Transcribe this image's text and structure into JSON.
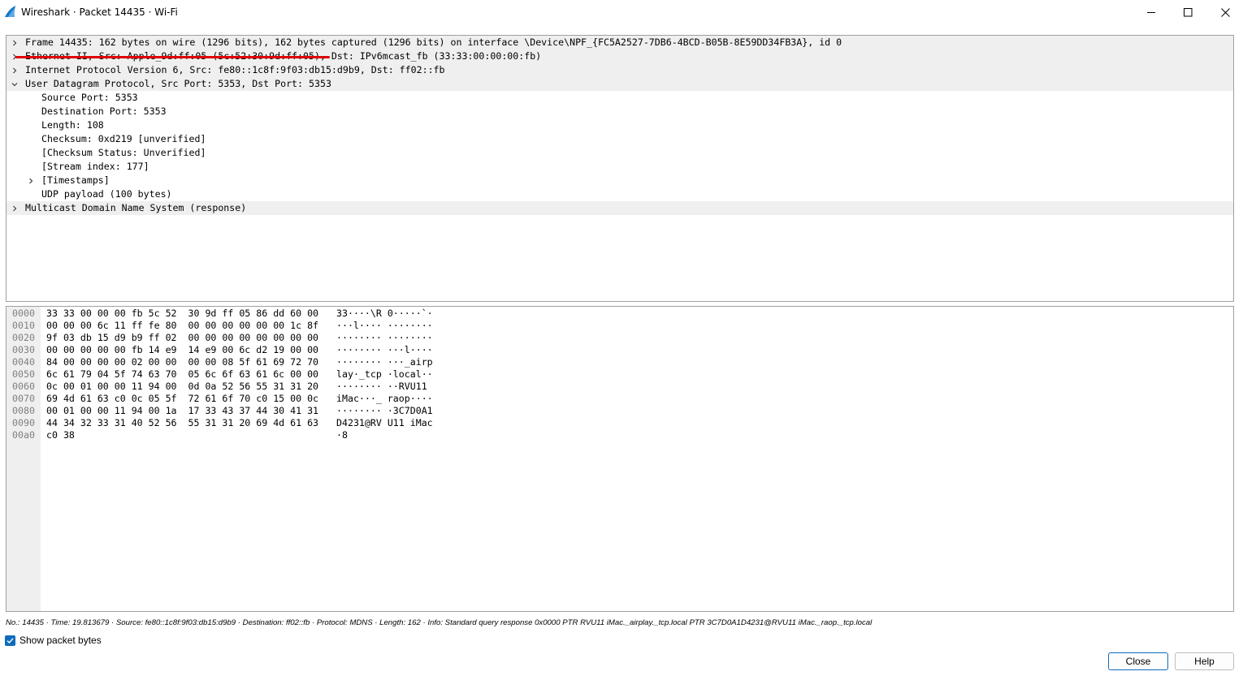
{
  "window": {
    "title": "Wireshark · Packet 14435 · Wi-Fi",
    "icon": "wireshark-fin-icon",
    "accent": "#0f6cbd"
  },
  "tree": {
    "rows": [
      {
        "text": "Frame 14435: 162 bytes on wire (1296 bits), 162 bytes captured (1296 bits) on interface \\Device\\NPF_{FC5A2527-7DB6-4BCD-B05B-8E59DD34FB3A}, id 0",
        "expander": "collapsed",
        "level": 0,
        "shaded": true
      },
      {
        "text": "Ethernet II, Src: Apple_9d:ff:05 (5c:52:30:9d:ff:05), Dst: IPv6mcast_fb (33:33:00:00:00:fb)",
        "expander": "collapsed",
        "level": 0,
        "shaded": true
      },
      {
        "text": "Internet Protocol Version 6, Src: fe80::1c8f:9f03:db15:d9b9, Dst: ff02::fb",
        "expander": "collapsed",
        "level": 0,
        "shaded": true
      },
      {
        "text": "User Datagram Protocol, Src Port: 5353, Dst Port: 5353",
        "expander": "expanded",
        "level": 0,
        "shaded": true
      },
      {
        "text": "Source Port: 5353",
        "expander": "none",
        "level": 1,
        "shaded": false
      },
      {
        "text": "Destination Port: 5353",
        "expander": "none",
        "level": 1,
        "shaded": false
      },
      {
        "text": "Length: 108",
        "expander": "none",
        "level": 1,
        "shaded": false
      },
      {
        "text": "Checksum: 0xd219 [unverified]",
        "expander": "none",
        "level": 1,
        "shaded": false
      },
      {
        "text": "[Checksum Status: Unverified]",
        "expander": "none",
        "level": 1,
        "shaded": false
      },
      {
        "text": "[Stream index: 177]",
        "expander": "none",
        "level": 1,
        "shaded": false
      },
      {
        "text": "[Timestamps]",
        "expander": "collapsed",
        "level": 1,
        "shaded": false
      },
      {
        "text": "UDP payload (100 bytes)",
        "expander": "none",
        "level": 1,
        "shaded": false
      },
      {
        "text": "Multicast Domain Name System (response)",
        "expander": "collapsed",
        "level": 0,
        "shaded": true
      }
    ],
    "highlight_color": "#e00000"
  },
  "bytes": {
    "rows": [
      {
        "offset": "0000",
        "hex": "33 33 00 00 00 fb 5c 52  30 9d ff 05 86 dd 60 00",
        "ascii": "33····\\R 0·····`·"
      },
      {
        "offset": "0010",
        "hex": "00 00 00 6c 11 ff fe 80  00 00 00 00 00 00 1c 8f",
        "ascii": "···l···· ········"
      },
      {
        "offset": "0020",
        "hex": "9f 03 db 15 d9 b9 ff 02  00 00 00 00 00 00 00 00",
        "ascii": "········ ········"
      },
      {
        "offset": "0030",
        "hex": "00 00 00 00 00 fb 14 e9  14 e9 00 6c d2 19 00 00",
        "ascii": "········ ···l····"
      },
      {
        "offset": "0040",
        "hex": "84 00 00 00 00 02 00 00  00 00 08 5f 61 69 72 70",
        "ascii": "········ ···_airp"
      },
      {
        "offset": "0050",
        "hex": "6c 61 79 04 5f 74 63 70  05 6c 6f 63 61 6c 00 00",
        "ascii": "lay·_tcp ·local··"
      },
      {
        "offset": "0060",
        "hex": "0c 00 01 00 00 11 94 00  0d 0a 52 56 55 31 31 20",
        "ascii": "········ ··RVU11 "
      },
      {
        "offset": "0070",
        "hex": "69 4d 61 63 c0 0c 05 5f  72 61 6f 70 c0 15 00 0c",
        "ascii": "iMac···_ raop····"
      },
      {
        "offset": "0080",
        "hex": "00 01 00 00 11 94 00 1a  17 33 43 37 44 30 41 31",
        "ascii": "········ ·3C7D0A1"
      },
      {
        "offset": "0090",
        "hex": "44 34 32 33 31 40 52 56  55 31 31 20 69 4d 61 63",
        "ascii": "D4231@RV U11 iMac"
      },
      {
        "offset": "00a0",
        "hex": "c0 38",
        "ascii": "·8"
      }
    ]
  },
  "status": {
    "text": "No.: 14435 · Time: 19.813679 · Source: fe80::1c8f:9f03:db15:d9b9 · Destination: ff02::fb · Protocol: MDNS · Length: 162 · Info: Standard query response 0x0000 PTR RVU11 iMac._airplay._tcp.local PTR 3C7D0A1D4231@RVU11 iMac._raop._tcp.local"
  },
  "footer": {
    "show_bytes_label": "Show packet bytes",
    "show_bytes_checked": true,
    "close_label": "Close",
    "help_label": "Help"
  }
}
